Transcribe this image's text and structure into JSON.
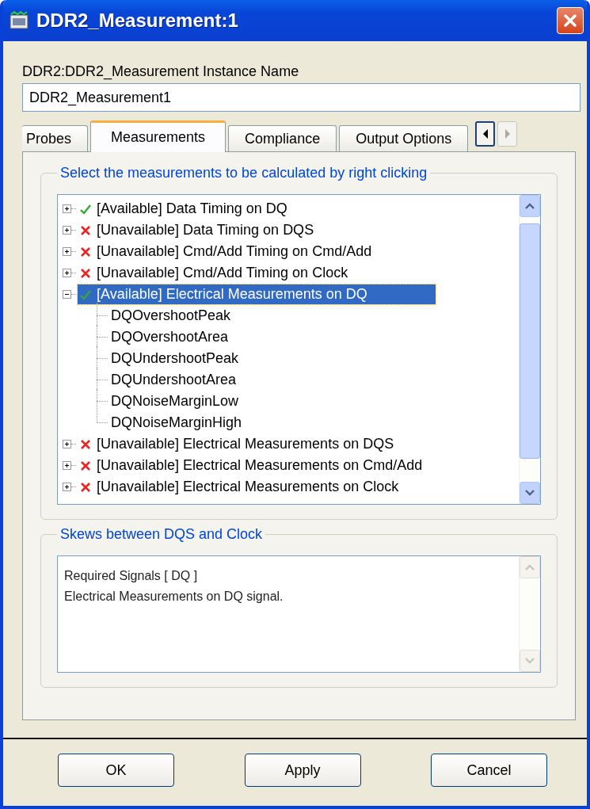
{
  "window": {
    "title": "DDR2_Measurement:1"
  },
  "instance": {
    "label": "DDR2:DDR2_Measurement Instance Name",
    "value": "DDR2_Measurement1"
  },
  "tabs": [
    {
      "label": "Probes",
      "selected": false
    },
    {
      "label": "Measurements",
      "selected": true
    },
    {
      "label": "Compliance",
      "selected": false
    },
    {
      "label": "Output Options",
      "selected": false
    }
  ],
  "tab_scroll": {
    "left_disabled": false,
    "right_disabled": true
  },
  "measurements": {
    "title": "Select the measurements to be calculated by right clicking",
    "items": [
      {
        "label": "[Available] Data Timing on DQ",
        "available": true,
        "expanded": false,
        "selected": false
      },
      {
        "label": "[Unavailable] Data Timing on DQS",
        "available": false,
        "expanded": false,
        "selected": false
      },
      {
        "label": "[Unavailable] Cmd/Add Timing on Cmd/Add",
        "available": false,
        "expanded": false,
        "selected": false
      },
      {
        "label": "[Unavailable] Cmd/Add Timing on Clock",
        "available": false,
        "expanded": false,
        "selected": false
      },
      {
        "label": "[Available] Electrical Measurements on DQ",
        "available": true,
        "expanded": true,
        "selected": true,
        "children": [
          {
            "label": "DQOvershootPeak"
          },
          {
            "label": "DQOvershootArea"
          },
          {
            "label": "DQUndershootPeak"
          },
          {
            "label": "DQUndershootArea"
          },
          {
            "label": "DQNoiseMarginLow"
          },
          {
            "label": "DQNoiseMarginHigh"
          }
        ]
      },
      {
        "label": "[Unavailable] Electrical Measurements on DQS",
        "available": false,
        "expanded": false,
        "selected": false
      },
      {
        "label": "[Unavailable] Electrical Measurements on Cmd/Add",
        "available": false,
        "expanded": false,
        "selected": false
      },
      {
        "label": "[Unavailable] Electrical Measurements on Clock",
        "available": false,
        "expanded": false,
        "selected": false
      }
    ]
  },
  "description": {
    "title": "Skews between DQS and Clock",
    "lines": [
      "Required Signals  [ DQ ]",
      "Electrical Measurements on DQ signal."
    ]
  },
  "buttons": [
    "OK",
    "Apply",
    "Cancel"
  ]
}
